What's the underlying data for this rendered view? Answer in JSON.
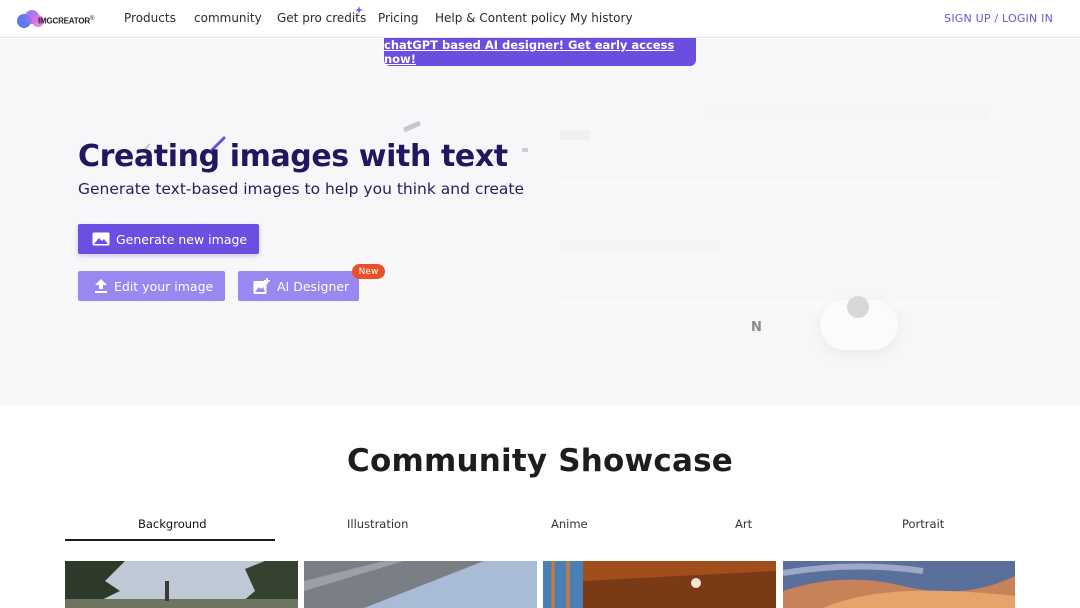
{
  "header": {
    "logo_text": "IMGCREATOR",
    "logo_sup": "®",
    "nav": [
      {
        "label": "Products"
      },
      {
        "label": "community"
      },
      {
        "label": "Get pro credits"
      },
      {
        "label": "Pricing"
      },
      {
        "label": "Help & Content policy"
      },
      {
        "label": "My history"
      }
    ],
    "auth_label": "SIGN UP / LOGIN IN"
  },
  "banner": {
    "label": "chatGPT based AI designer! Get early access now!"
  },
  "hero": {
    "title": "Creating images with text",
    "subtitle": "Generate text-based images to help you think and create",
    "primary_button": "Generate new image",
    "edit_button": "Edit your image",
    "ai_button": "AI Designer",
    "new_badge": "New",
    "preview_letter": "N"
  },
  "showcase": {
    "title": "Community Showcase",
    "tabs": [
      {
        "label": "Background",
        "active": true
      },
      {
        "label": "Illustration"
      },
      {
        "label": "Anime"
      },
      {
        "label": "Art"
      },
      {
        "label": "Portrait"
      }
    ]
  },
  "colors": {
    "accent": "#6a4fe0",
    "accent_light": "#9b87f0",
    "badge": "#e8502a",
    "title": "#231560"
  }
}
